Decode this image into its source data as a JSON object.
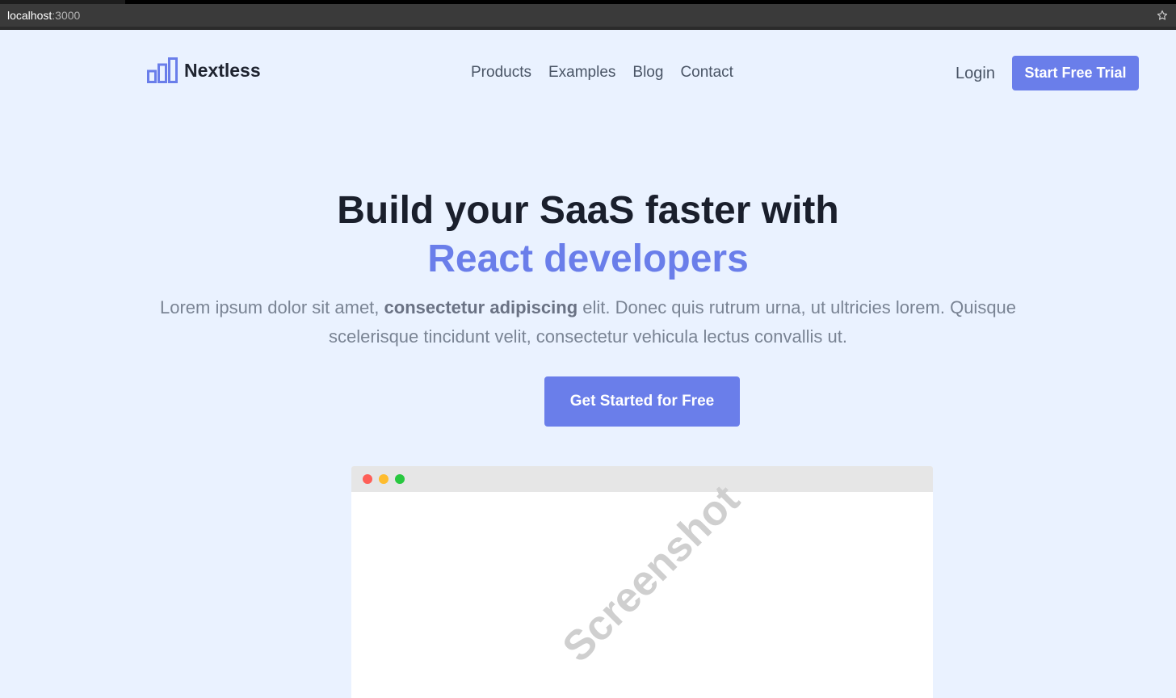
{
  "browser": {
    "url_host": "localhost",
    "url_port": ":3000",
    "bookmark_icon": "star-icon"
  },
  "nav": {
    "logo_icon": "bar-chart-icon",
    "brand": "Nextless",
    "links": [
      "Products",
      "Examples",
      "Blog",
      "Contact"
    ],
    "login": "Login",
    "trial_button": "Start Free Trial"
  },
  "hero": {
    "title_line1": "Build your SaaS faster with",
    "title_line2": "React developers",
    "subtitle_part1": "Lorem ipsum dolor sit amet, ",
    "subtitle_bold": "consectetur adipiscing",
    "subtitle_part2": " elit. Donec quis rutrum urna, ut ultricies lorem. Quisque scelerisque tincidunt velit, consectetur vehicula lectus convallis ut.",
    "cta_label": "Get Started for Free"
  },
  "preview": {
    "watermark": "Screenshot"
  },
  "colors": {
    "accent": "#6a7eea",
    "background": "#eaf2ff",
    "heading": "#1a1f2c",
    "muted": "#7a8494"
  }
}
